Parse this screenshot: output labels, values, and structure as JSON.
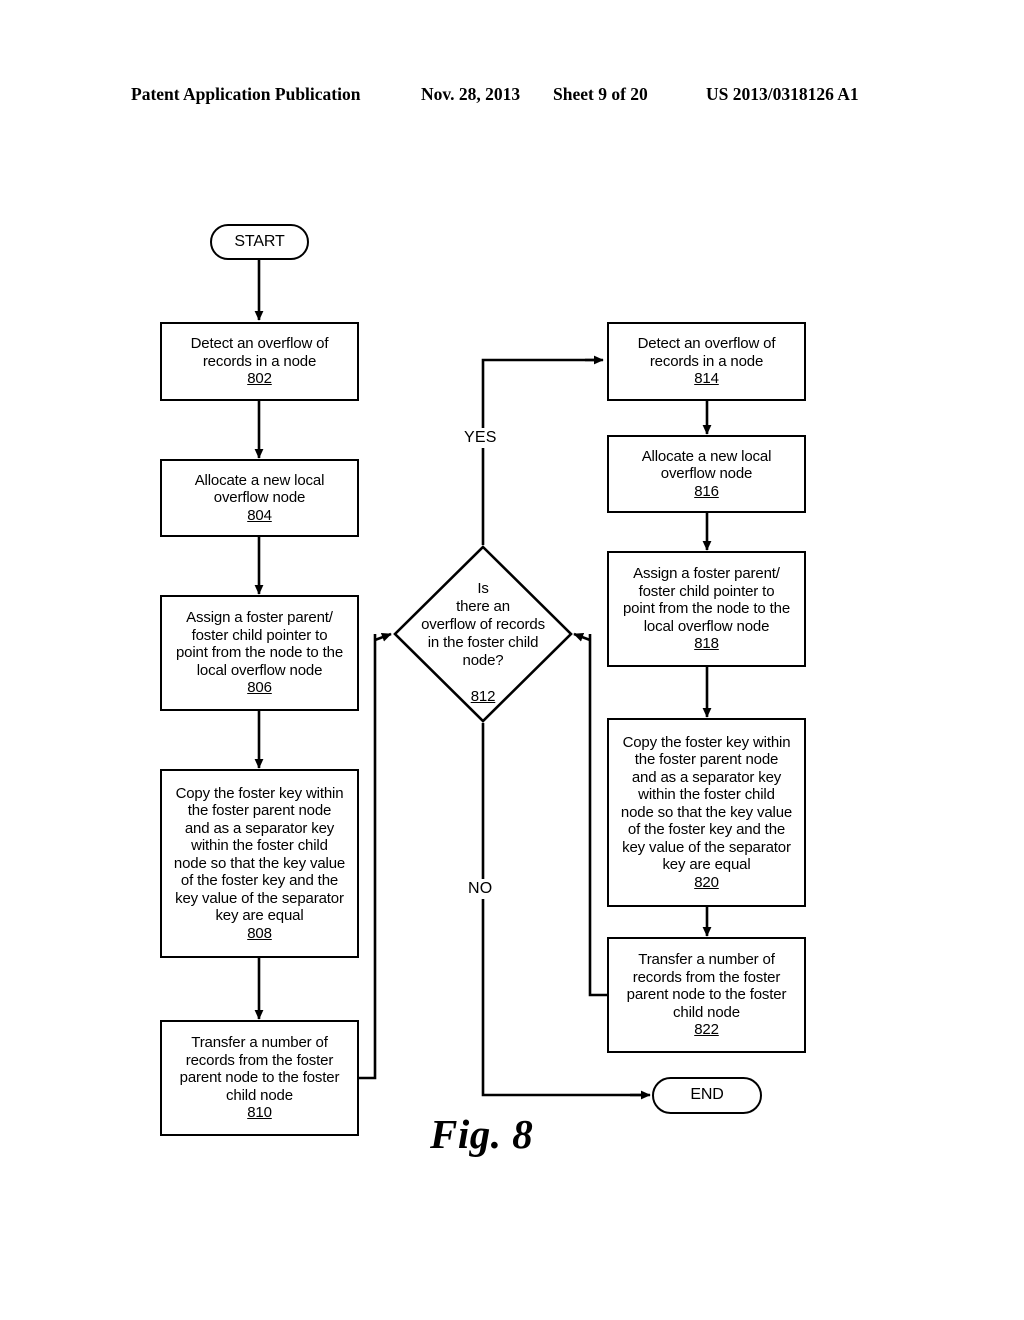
{
  "header": {
    "publication": "Patent Application Publication",
    "date": "Nov. 28, 2013",
    "sheet": "Sheet 9 of 20",
    "patent_number": "US 2013/0318126 A1"
  },
  "figure": {
    "caption": "Fig. 8"
  },
  "flowchart": {
    "terminals": {
      "start": "START",
      "end": "END"
    },
    "branch_labels": {
      "yes": "YES",
      "no": "NO"
    },
    "decision": {
      "text": "Is\nthere an\noverflow of records\nin the foster child\nnode?",
      "ref": "812"
    },
    "steps": [
      {
        "id": "step-802",
        "text": "Detect an overflow of\nrecords in a node",
        "ref": "802"
      },
      {
        "id": "step-804",
        "text": "Allocate a new local\noverflow node",
        "ref": "804"
      },
      {
        "id": "step-806",
        "text": "Assign a foster parent/\nfoster child pointer to\npoint from the node to the\nlocal overflow node",
        "ref": "806"
      },
      {
        "id": "step-808",
        "text": "Copy the foster key within\nthe foster parent node\nand as a separator key\nwithin the foster child\nnode so that the key value\nof the foster key and the\nkey value of the separator\nkey are equal",
        "ref": "808"
      },
      {
        "id": "step-810",
        "text": "Transfer a number of\nrecords from the foster\nparent node to the foster\nchild node",
        "ref": "810"
      },
      {
        "id": "step-814",
        "text": "Detect an overflow of\nrecords in a node",
        "ref": "814"
      },
      {
        "id": "step-816",
        "text": "Allocate a new local\noverflow node",
        "ref": "816"
      },
      {
        "id": "step-818",
        "text": "Assign a foster parent/\nfoster child pointer to\npoint from the node to the\nlocal overflow node",
        "ref": "818"
      },
      {
        "id": "step-820",
        "text": "Copy the foster key within\nthe foster parent node\nand as a separator key\nwithin the foster child\nnode so that the key value\nof the foster key and the\nkey value of the separator\nkey are equal",
        "ref": "820"
      },
      {
        "id": "step-822",
        "text": "Transfer a number of\nrecords from the foster\nparent node to the foster\nchild node",
        "ref": "822"
      }
    ]
  }
}
